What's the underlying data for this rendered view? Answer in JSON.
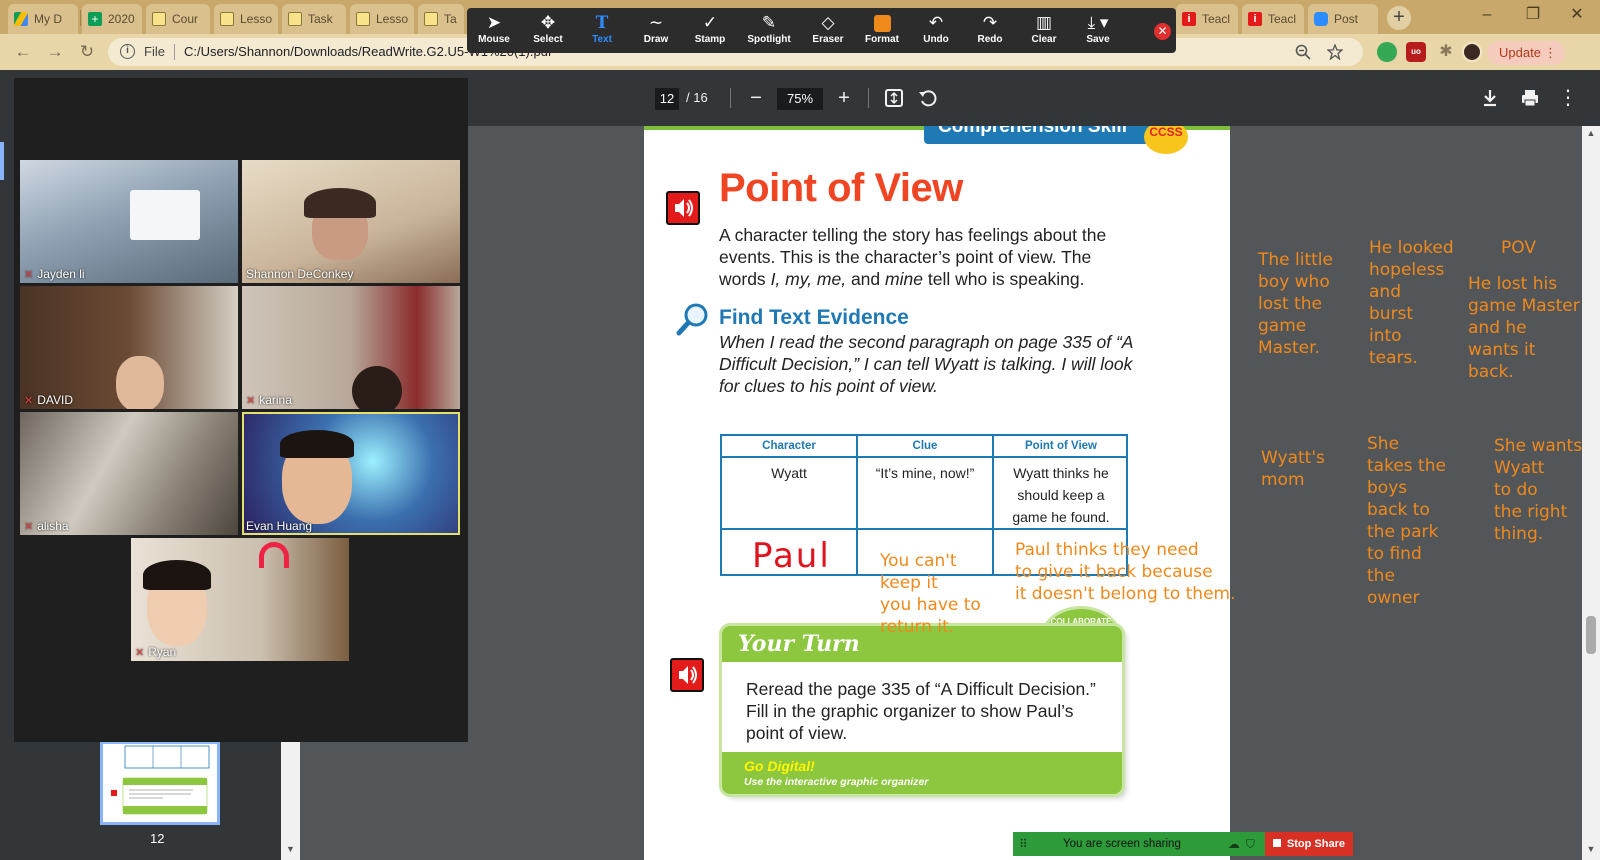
{
  "browser": {
    "tabs": [
      {
        "label": "My D",
        "color": "#fbbc04"
      },
      {
        "label": "2020",
        "color": "#0f9d58"
      },
      {
        "label": "Cour",
        "color": "#f9e38a"
      },
      {
        "label": "Lesso",
        "color": "#f9e38a"
      },
      {
        "label": "Task",
        "color": "#f9e38a"
      },
      {
        "label": "Lesso",
        "color": "#f9e38a"
      },
      {
        "label": "Ta",
        "color": "#f9e38a"
      },
      {
        "label": "Teacl",
        "color": "#e31b1b"
      },
      {
        "label": "Teacl",
        "color": "#e31b1b"
      },
      {
        "label": "Post",
        "color": "#2d8cff"
      }
    ],
    "new_tab": "+",
    "window_controls": {
      "minimize": "–",
      "restore": "❐",
      "close": "✕"
    },
    "scheme_label": "File",
    "url": "C:/Users/Shannon/Downloads/ReadWrite.G2.U5-W1%20(1).pdf",
    "update_label": "Update"
  },
  "annotate": {
    "tools": [
      {
        "label": "Mouse",
        "icon": "cursor-icon",
        "glyph": "➤"
      },
      {
        "label": "Select",
        "icon": "move-icon",
        "glyph": "✥"
      },
      {
        "label": "Text",
        "icon": "text-icon",
        "glyph": "T"
      },
      {
        "label": "Draw",
        "icon": "draw-icon",
        "glyph": "〜"
      },
      {
        "label": "Stamp",
        "icon": "stamp-icon",
        "glyph": "✓"
      },
      {
        "label": "Spotlight",
        "icon": "spotlight-icon",
        "glyph": "✎"
      },
      {
        "label": "Eraser",
        "icon": "eraser-icon",
        "glyph": "◇"
      },
      {
        "label": "Format",
        "icon": "format-icon",
        "glyph": "■"
      },
      {
        "label": "Undo",
        "icon": "undo-icon",
        "glyph": "↶"
      },
      {
        "label": "Redo",
        "icon": "redo-icon",
        "glyph": "↷"
      },
      {
        "label": "Clear",
        "icon": "trash-icon",
        "glyph": "🗑"
      },
      {
        "label": "Save",
        "icon": "save-icon",
        "glyph": "⤓"
      }
    ],
    "active_tool": "Text",
    "format_color": "#f0891c"
  },
  "pdf": {
    "current_page": "12",
    "total_pages": "/ 16",
    "zoom": "75%",
    "thumb_page": "12"
  },
  "page": {
    "banner": "Comprehension Skill",
    "badge": "CCSS",
    "title": "Point of View",
    "intro_1": "A character telling the story has feelings about the events. This is the character’s point of view.",
    "intro_2a": "The words",
    "intro_2b": "I, my, me,",
    "intro_2c": "and",
    "intro_2d": "mine",
    "intro_2e": "tell who is speaking.",
    "fte_title": "Find Text Evidence",
    "fte_text": "When I read the second paragraph on page 335 of “A Difficult Decision,” I can tell Wyatt is talking. I will look for clues to his point of view.",
    "organizer": {
      "headers": [
        "Character",
        "Clue",
        "Point of View"
      ],
      "row1": [
        "Wyatt",
        "“It’s mine, now!”",
        "Wyatt thinks he should keep a game he found."
      ],
      "handwritten": "Paul"
    },
    "your_turn_title": "Your Turn",
    "your_turn_body": "Reread the page 335 of “A Difficult Decision.” Fill in the graphic organizer to show Paul’s point of view.",
    "go_digital": "Go Digital!",
    "go_digital_sub": "Use the interactive graphic organizer",
    "collaborate": "COLLABORATE"
  },
  "annotations": {
    "clue_paul": "You can't\nkeep it\nyou have to\nreturn it.",
    "pov_paul": "Paul thinks they need\nto give it back because\nit doesn't belong to them.",
    "col1_top": "The little\nboy who\nlost the\ngame\nMaster.",
    "col2_top": "He looked\nhopeless\nand\nburst\ninto\ntears.",
    "col3_head": "POV",
    "col3_top": "He lost his\ngame Master\nand he\nwants it\nback.",
    "col1_bottom": "Wyatt's\nmom",
    "col2_bottom": "She\ntakes the\nboys\nback to\nthe park\nto find\nthe\nowner",
    "col3_bottom": "She wants\nWyatt\nto do\nthe right\nthing."
  },
  "zoom": {
    "participants": [
      {
        "name": "Jayden li",
        "muted": true,
        "bg": "#8fa1b3"
      },
      {
        "name": "Shannon DeConkey",
        "muted": false,
        "bg": "#c9b49a"
      },
      {
        "name": "DAVID",
        "muted": true,
        "bg": "#5e4433"
      },
      {
        "name": "karina",
        "muted": true,
        "bg": "#b7a89a"
      },
      {
        "name": "alisha",
        "muted": true,
        "bg": "#9d9488"
      },
      {
        "name": "Evan Huang",
        "muted": false,
        "bg": "#3b6fae"
      },
      {
        "name": "Ryan",
        "muted": true,
        "bg": "#cbbfae"
      }
    ]
  },
  "share": {
    "status": "You are screen sharing",
    "stop_label": "Stop Share"
  }
}
